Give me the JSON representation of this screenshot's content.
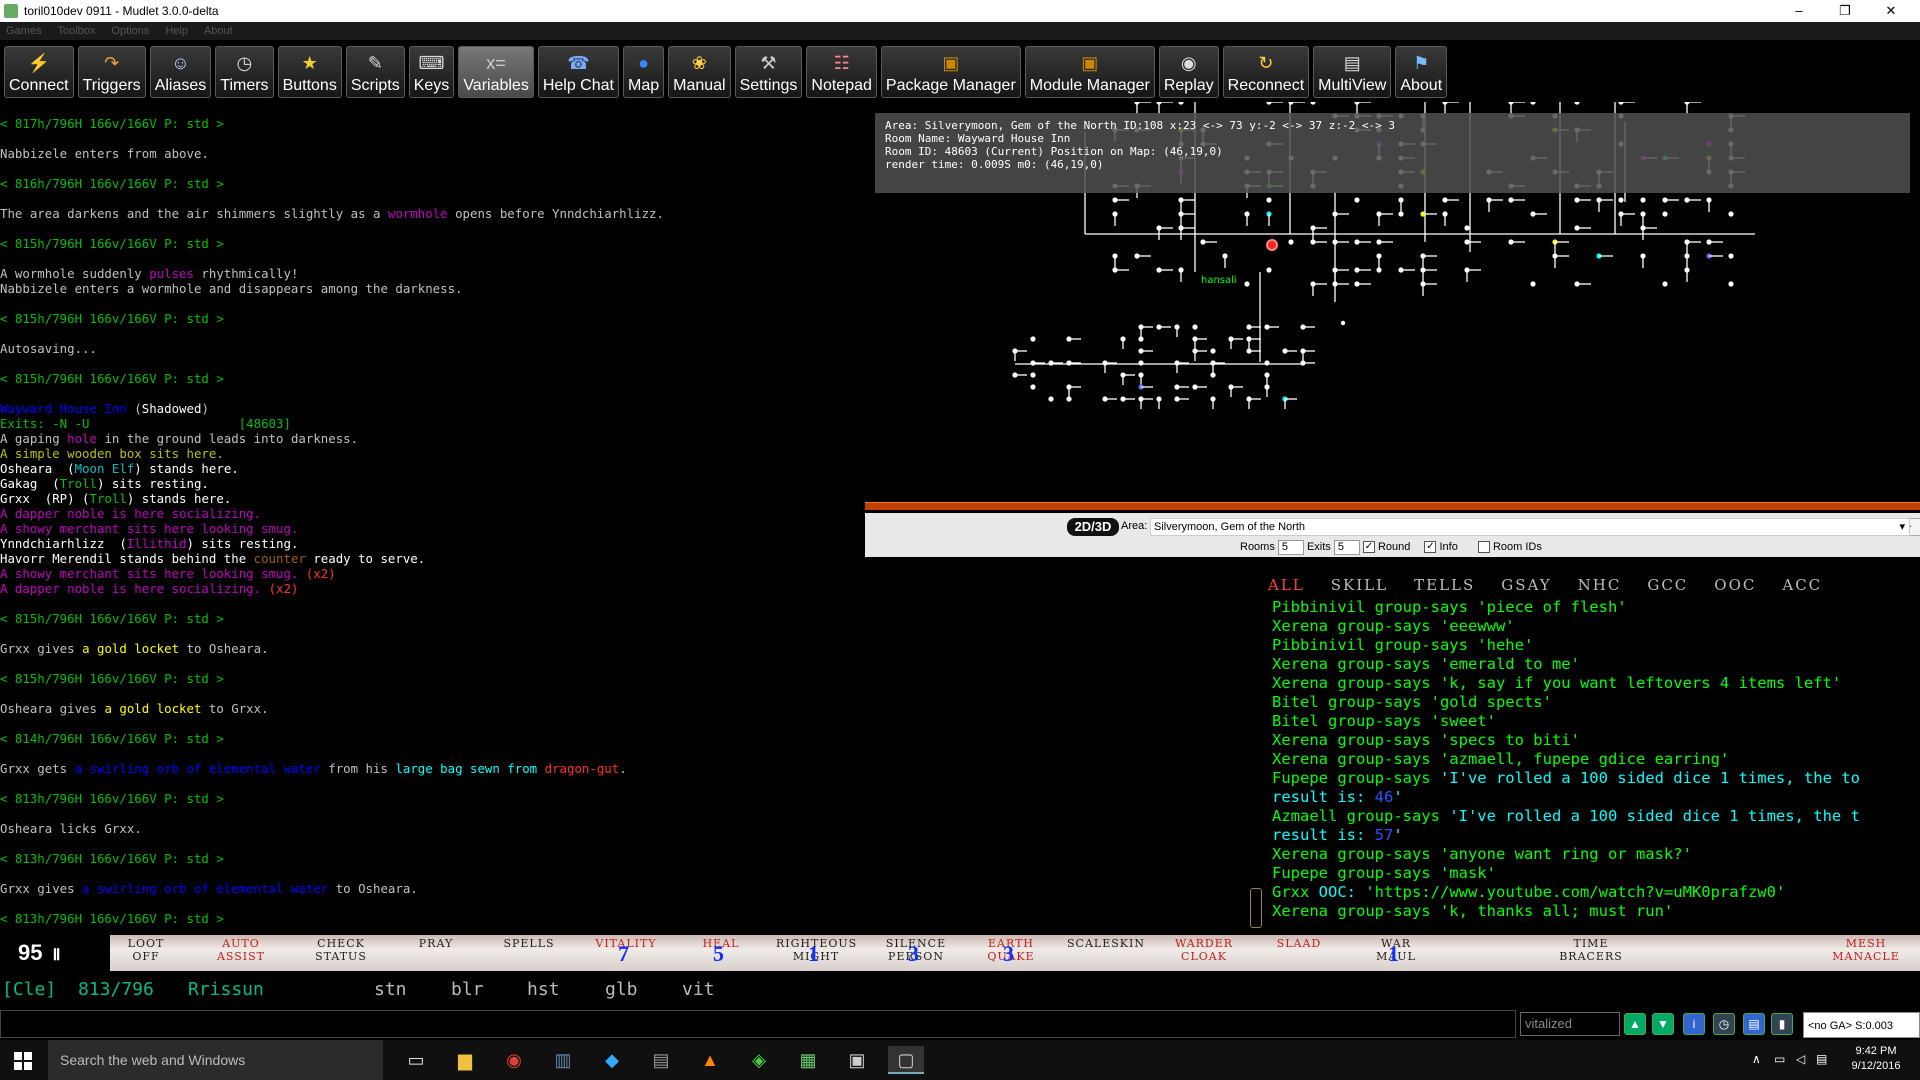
{
  "window": {
    "title": "toril010dev 0911 - Mudlet 3.0.0-delta",
    "minimize": "–",
    "maximize": "❐",
    "close": "✕"
  },
  "menu": [
    "Games",
    "Toolbox",
    "Options",
    "Help",
    "About"
  ],
  "toolbar": [
    {
      "label": "Connect",
      "icon": "⚡"
    },
    {
      "label": "Triggers",
      "icon": "↷"
    },
    {
      "label": "Aliases",
      "icon": "☺"
    },
    {
      "label": "Timers",
      "icon": "◷"
    },
    {
      "label": "Buttons",
      "icon": "★"
    },
    {
      "label": "Scripts",
      "icon": "✎"
    },
    {
      "label": "Keys",
      "icon": "⌨"
    },
    {
      "label": "Variables",
      "icon": "x="
    },
    {
      "label": "Help Chat",
      "icon": "☎"
    },
    {
      "label": "Map",
      "icon": "●"
    },
    {
      "label": "Manual",
      "icon": "❀"
    },
    {
      "label": "Settings",
      "icon": "⚒"
    },
    {
      "label": "Notepad",
      "icon": "☷"
    },
    {
      "label": "Package Manager",
      "icon": "▣"
    },
    {
      "label": "Module Manager",
      "icon": "▣"
    },
    {
      "label": "Replay",
      "icon": "◉"
    },
    {
      "label": "Reconnect",
      "icon": "↻"
    },
    {
      "label": "MultiView",
      "icon": "▤"
    },
    {
      "label": "About",
      "icon": "⚑"
    }
  ],
  "console": [
    {
      "t": [
        {
          "c": "c-green",
          "s": "< 817h/796H 166v/166V P: std >"
        }
      ]
    },
    {
      "t": []
    },
    {
      "t": [
        {
          "c": "",
          "s": "Nabbizele enters from above."
        }
      ]
    },
    {
      "t": []
    },
    {
      "t": [
        {
          "c": "c-green",
          "s": "< 816h/796H 166v/166V P: std >"
        }
      ]
    },
    {
      "t": []
    },
    {
      "t": [
        {
          "c": "",
          "s": "The area darkens and the air shimmers slightly as a "
        },
        {
          "c": "c-mag",
          "s": "wormhole"
        },
        {
          "c": "",
          "s": " opens before Ynndchiarhlizz."
        }
      ]
    },
    {
      "t": []
    },
    {
      "t": [
        {
          "c": "c-green",
          "s": "< 815h/796H 166v/166V P: std >"
        }
      ]
    },
    {
      "t": []
    },
    {
      "t": [
        {
          "c": "",
          "s": "A wormhole suddenly "
        },
        {
          "c": "c-mag",
          "s": "pulses"
        },
        {
          "c": "",
          "s": " rhythmically!"
        }
      ]
    },
    {
      "t": [
        {
          "c": "",
          "s": "Nabbizele enters a wormhole and disappears among the darkness."
        }
      ]
    },
    {
      "t": []
    },
    {
      "t": [
        {
          "c": "c-green",
          "s": "< 815h/796H 166v/166V P: std >"
        }
      ]
    },
    {
      "t": []
    },
    {
      "t": [
        {
          "c": "",
          "s": "Autosaving..."
        }
      ]
    },
    {
      "t": []
    },
    {
      "t": [
        {
          "c": "c-green",
          "s": "< 815h/796H 166v/166V P: std >"
        }
      ]
    },
    {
      "t": []
    },
    {
      "t": [
        {
          "c": "c-blue",
          "s": "Wayward House Inn"
        },
        {
          "c": "",
          "s": " ("
        },
        {
          "c": "c-bright",
          "s": "Shadowed"
        },
        {
          "c": "",
          "s": ")"
        }
      ]
    },
    {
      "t": [
        {
          "c": "c-green",
          "s": "Exits: -N -U                    [48603]"
        }
      ]
    },
    {
      "t": [
        {
          "c": "",
          "s": "A gaping "
        },
        {
          "c": "c-mag",
          "s": "hole"
        },
        {
          "c": "",
          "s": " in the ground leads into darkness."
        }
      ]
    },
    {
      "t": [
        {
          "c": "c-yellow",
          "s": "A simple wooden box sits here."
        }
      ]
    },
    {
      "t": [
        {
          "c": "c-bright",
          "s": "Osheara  ("
        },
        {
          "c": "c-cyan",
          "s": "Moon Elf"
        },
        {
          "c": "c-bright",
          "s": ") stands here."
        }
      ]
    },
    {
      "t": [
        {
          "c": "c-bright",
          "s": "Gakag  ("
        },
        {
          "c": "c-green",
          "s": "Troll"
        },
        {
          "c": "c-bright",
          "s": ") sits resting."
        }
      ]
    },
    {
      "t": [
        {
          "c": "c-bright",
          "s": "Grxx  (RP) ("
        },
        {
          "c": "c-green",
          "s": "Troll"
        },
        {
          "c": "c-bright",
          "s": ") stands here."
        }
      ]
    },
    {
      "t": [
        {
          "c": "c-mag",
          "s": "A dapper noble is here socializing."
        }
      ]
    },
    {
      "t": [
        {
          "c": "c-mag",
          "s": "A showy merchant sits here looking smug."
        }
      ]
    },
    {
      "t": [
        {
          "c": "c-bright",
          "s": "Ynndchiarhlizz  ("
        },
        {
          "c": "c-mag",
          "s": "Illithid"
        },
        {
          "c": "c-bright",
          "s": ") sits resting."
        }
      ]
    },
    {
      "t": [
        {
          "c": "c-bright",
          "s": "Havorr Merendil stands behind the "
        },
        {
          "c": "c-brown",
          "s": "counter"
        },
        {
          "c": "c-bright",
          "s": " ready to serve."
        }
      ]
    },
    {
      "t": [
        {
          "c": "c-mag",
          "s": "A showy merchant sits here looking smug. "
        },
        {
          "c": "c-red",
          "s": "(x2)"
        }
      ]
    },
    {
      "t": [
        {
          "c": "c-mag",
          "s": "A dapper noble is here socializing. "
        },
        {
          "c": "c-red",
          "s": "(x2)"
        }
      ]
    },
    {
      "t": []
    },
    {
      "t": [
        {
          "c": "c-green",
          "s": "< 815h/796H 166v/166V P: std >"
        }
      ]
    },
    {
      "t": []
    },
    {
      "t": [
        {
          "c": "",
          "s": "Grxx gives "
        },
        {
          "c": "c-byellow",
          "s": "a gold locket"
        },
        {
          "c": "",
          "s": " to Osheara."
        }
      ]
    },
    {
      "t": []
    },
    {
      "t": [
        {
          "c": "c-green",
          "s": "< 815h/796H 166v/166V P: std >"
        }
      ]
    },
    {
      "t": []
    },
    {
      "t": [
        {
          "c": "",
          "s": "Osheara gives "
        },
        {
          "c": "c-byellow",
          "s": "a gold locket"
        },
        {
          "c": "",
          "s": " to Grxx."
        }
      ]
    },
    {
      "t": []
    },
    {
      "t": [
        {
          "c": "c-green",
          "s": "< 814h/796H 166v/166V P: std >"
        }
      ]
    },
    {
      "t": []
    },
    {
      "t": [
        {
          "c": "",
          "s": "Grxx gets "
        },
        {
          "c": "c-blue",
          "s": "a swirling orb of elemental water"
        },
        {
          "c": "",
          "s": " from his "
        },
        {
          "c": "c-bcyan",
          "s": "large bag sewn from"
        },
        {
          "c": "",
          "s": " "
        },
        {
          "c": "c-red",
          "s": "dragon-gut"
        },
        {
          "c": "",
          "s": "."
        }
      ]
    },
    {
      "t": []
    },
    {
      "t": [
        {
          "c": "c-green",
          "s": "< 813h/796H 166v/166V P: std >"
        }
      ]
    },
    {
      "t": []
    },
    {
      "t": [
        {
          "c": "",
          "s": "Osheara licks Grxx."
        }
      ]
    },
    {
      "t": []
    },
    {
      "t": [
        {
          "c": "c-green",
          "s": "< 813h/796H 166v/166V P: std >"
        }
      ]
    },
    {
      "t": []
    },
    {
      "t": [
        {
          "c": "",
          "s": "Grxx gives "
        },
        {
          "c": "c-blue",
          "s": "a swirling orb of elemental water"
        },
        {
          "c": "",
          "s": " to Osheara."
        }
      ]
    },
    {
      "t": []
    },
    {
      "t": [
        {
          "c": "c-green",
          "s": "< 813h/796H 166v/166V P: std >"
        }
      ]
    }
  ],
  "map": {
    "info_lines": [
      "Area: Silverymoon, Gem of the North ID:108 x:23 <-> 73 y:-2 <-> 37 z:-2 <-> 3",
      "Room Name: Wayward House Inn",
      "Room ID: 48603 (Current) Position on Map: (46,19,0)",
      "render time: 0.009S m0: (46,19,0)"
    ],
    "room_label": "hansali",
    "nav_left": "◂",
    "nav_down": "▼",
    "nav_up": "▲",
    "nav_right": "▸",
    "zoom_in": "+",
    "zoom_out": "-",
    "mode_button": "2D/3D",
    "area_label": "Area:",
    "area_value": "Silverymoon, Gem of the North",
    "rooms_label": "Rooms",
    "rooms_value": "5",
    "exits_label": "Exits",
    "exits_value": "5",
    "round_label": "Round",
    "round_checked": "✓",
    "info_label": "Info",
    "info_checked": "✓",
    "roomids_label": "Room IDs"
  },
  "chat": {
    "tabs": [
      "ALL",
      "SKILL",
      "TELLS",
      "GSAY",
      "NHC",
      "GCC",
      "OOC",
      "ACC"
    ],
    "lines": [
      {
        "parts": [
          {
            "c": "gr",
            "s": "Pibbinivil group-says 'piece of flesh'"
          }
        ]
      },
      {
        "parts": [
          {
            "c": "gr",
            "s": "Xerena group-says 'eeewww'"
          }
        ]
      },
      {
        "parts": [
          {
            "c": "gr",
            "s": "Pibbinivil group-says 'hehe'"
          }
        ]
      },
      {
        "parts": [
          {
            "c": "gr",
            "s": "Xerena group-says 'emerald to me'"
          }
        ]
      },
      {
        "parts": [
          {
            "c": "gr",
            "s": "Xerena group-says 'k, say if you want leftovers 4 items left'"
          }
        ]
      },
      {
        "parts": [
          {
            "c": "gr",
            "s": "Bitel group-says 'gold spects'"
          }
        ]
      },
      {
        "parts": [
          {
            "c": "gr",
            "s": "Bitel group-says 'sweet'"
          }
        ]
      },
      {
        "parts": [
          {
            "c": "gr",
            "s": "Xerena group-says 'specs to biti'"
          }
        ]
      },
      {
        "parts": [
          {
            "c": "gr",
            "s": "Xerena group-says 'azmaell, fupepe gdice earring'"
          }
        ]
      },
      {
        "parts": [
          {
            "c": "gr",
            "s": "Fupepe group-says "
          },
          {
            "c": "cy",
            "s": "'I've rolled a 100 sided dice 1 times, the to"
          }
        ]
      },
      {
        "parts": [
          {
            "c": "cy",
            "s": "result is: "
          },
          {
            "c": "bl",
            "s": "46"
          },
          {
            "c": "cy",
            "s": "'"
          }
        ]
      },
      {
        "parts": [
          {
            "c": "gr",
            "s": "Azmaell group-says "
          },
          {
            "c": "cy",
            "s": "'I've rolled a 100 sided dice 1 times, the t"
          }
        ]
      },
      {
        "parts": [
          {
            "c": "cy",
            "s": "result is: "
          },
          {
            "c": "bl",
            "s": "57"
          },
          {
            "c": "cy",
            "s": "'"
          }
        ]
      },
      {
        "parts": [
          {
            "c": "gr",
            "s": "Xerena group-says 'anyone want ring or mask?'"
          }
        ]
      },
      {
        "parts": [
          {
            "c": "gr",
            "s": "Fupepe group-says 'mask'"
          }
        ]
      },
      {
        "parts": [
          {
            "c": "gr",
            "s": "Grxx "
          },
          {
            "c": "cy",
            "s": "OOC: "
          },
          {
            "c": "gr",
            "s": "'https://www.youtube.com/watch?v=uMK0prafzw0'"
          }
        ]
      },
      {
        "parts": [
          {
            "c": "gr",
            "s": "Xerena group-says 'k, thanks all; must run'"
          }
        ]
      }
    ]
  },
  "hp": "95",
  "hp_icon": "Ⅱ",
  "buttonbar": [
    {
      "l1": "Loot",
      "l2": "Off",
      "red": false
    },
    {
      "l1": "Auto",
      "l2": "Assist",
      "red": true
    },
    {
      "l1": "Check",
      "l2": "Status",
      "red": false
    },
    {
      "l1": "Pray",
      "l2": "",
      "red": false
    },
    {
      "l1": "Spells",
      "l2": "",
      "red": false
    },
    {
      "l1": "Vitality",
      "l2": "",
      "red": true,
      "count": "7"
    },
    {
      "l1": "Heal",
      "l2": "",
      "red": true,
      "count": "5"
    },
    {
      "l1": "Righteous",
      "l2": "Might",
      "red": false,
      "count": "1"
    },
    {
      "l1": "Silence",
      "l2": "Person",
      "red": false,
      "count": "3"
    },
    {
      "l1": "Earth",
      "l2": "Quake",
      "red": true,
      "count": "3"
    },
    {
      "l1": "Scaleskin",
      "l2": "",
      "red": false
    },
    {
      "l1": "Warder",
      "l2": "Cloak",
      "red": true
    },
    {
      "l1": "Slaad",
      "l2": "",
      "red": true
    },
    {
      "l1": "War",
      "l2": "Maul",
      "red": false,
      "count": "1"
    },
    {
      "l1": "Time",
      "l2": "Bracers",
      "red": false
    },
    {
      "l1": "Mesh",
      "l2": "Manacle",
      "red": true
    }
  ],
  "status": {
    "target": "[Cle]",
    "hp": "813/796",
    "name": "Rrissun",
    "s1": "stn",
    "s2": "blr",
    "s3": "hst",
    "s4": "glb",
    "s5": "vit"
  },
  "input": {
    "vitalized": "vitalized",
    "ga_status": "<no GA> S:0.003"
  },
  "taskbar": {
    "search_placeholder": "Search the web and Windows",
    "apps": [
      "task-view",
      "file-explorer",
      "chrome",
      "library",
      "git",
      "database",
      "vlc",
      "mudlet",
      "notepad",
      "terminal",
      "active-window"
    ],
    "time": "9:42 PM",
    "date": "9/12/2016"
  }
}
